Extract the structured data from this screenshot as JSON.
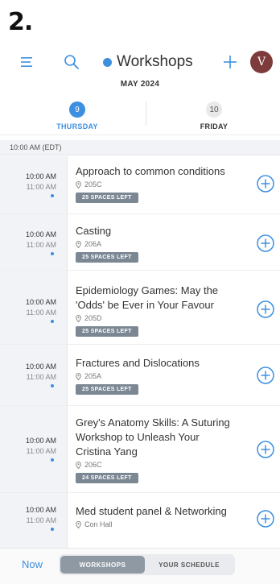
{
  "step_label": "2.",
  "header": {
    "title": "Workshops",
    "avatar_initial": "V",
    "accent": "#3d8fe0"
  },
  "month": "MAY 2024",
  "days": [
    {
      "num": "9",
      "name": "THURSDAY",
      "selected": true
    },
    {
      "num": "10",
      "name": "FRIDAY",
      "selected": false
    }
  ],
  "section": "10:00 AM (EDT)",
  "events": [
    {
      "start": "10:00 AM",
      "end": "11:00 AM",
      "title_lines": [
        "Approach to common conditions"
      ],
      "room": "205C",
      "spaces": "25 SPACES LEFT"
    },
    {
      "start": "10:00 AM",
      "end": "11:00 AM",
      "title_lines": [
        "Casting"
      ],
      "room": "206A",
      "spaces": "25 SPACES LEFT"
    },
    {
      "start": "10:00 AM",
      "end": "11:00 AM",
      "title_lines": [
        "Epidemiology Games: May the",
        "'Odds' be Ever in Your Favour"
      ],
      "room": "205D",
      "spaces": "25 SPACES LEFT"
    },
    {
      "start": "10:00 AM",
      "end": "11:00 AM",
      "title_lines": [
        "Fractures and Dislocations"
      ],
      "room": "205A",
      "spaces": "25 SPACES LEFT"
    },
    {
      "start": "10:00 AM",
      "end": "11:00 AM",
      "title_lines": [
        "Grey's Anatomy Skills: A Suturing",
        "Workshop to Unleash Your",
        "Cristina Yang"
      ],
      "room": "206C",
      "spaces": "24 SPACES LEFT"
    },
    {
      "start": "10:00 AM",
      "end": "11:00 AM",
      "title_lines": [
        "Med student panel & Networking"
      ],
      "room": "Con Hall",
      "spaces": ""
    }
  ],
  "bottom": {
    "now": "Now",
    "tab_workshops": "WORKSHOPS",
    "tab_schedule": "YOUR SCHEDULE"
  },
  "icons": [
    "menu-icon",
    "search-icon",
    "plus-icon",
    "location-pin-icon",
    "add-circle-icon"
  ]
}
